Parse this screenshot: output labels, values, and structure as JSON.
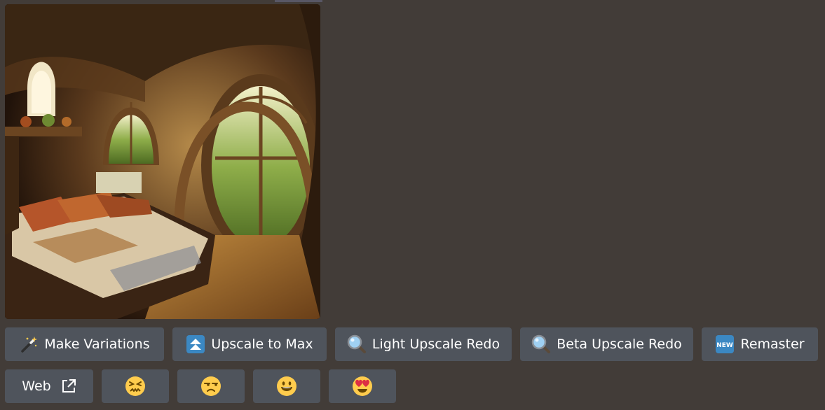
{
  "message": {
    "image": {
      "alt": "",
      "subject": "cozy tree-house bedroom interior with arched windows and woven bedding"
    },
    "row1": [
      {
        "label": "Make Variations",
        "icon": "magic-wand-icon"
      },
      {
        "label": "Upscale to Max",
        "icon": "double-up-arrow-icon"
      },
      {
        "label": "Light Upscale Redo",
        "icon": "magnifier-icon"
      },
      {
        "label": "Beta Upscale Redo",
        "icon": "magnifier-icon"
      },
      {
        "label": "Remaster",
        "icon": "new-badge-icon"
      }
    ],
    "row2": {
      "web_label": "Web",
      "web_icon": "external-link-icon",
      "reactions": [
        {
          "name": "confounded-face-icon"
        },
        {
          "name": "unamused-face-icon"
        },
        {
          "name": "grinning-face-icon"
        },
        {
          "name": "heart-eyes-face-icon"
        }
      ]
    }
  },
  "colors": {
    "background": "#423c38",
    "button": "#4f545c",
    "text": "#ffffff",
    "new_badge": "#3b88c3",
    "emoji_yellow": "#ffcc4d"
  }
}
